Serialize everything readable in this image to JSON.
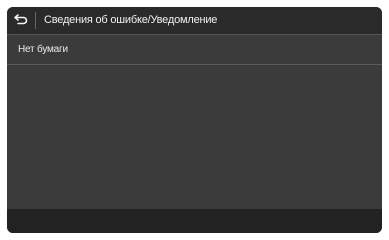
{
  "header": {
    "back_icon": "back-arrow-icon",
    "title": "Сведения об ошибке/Уведомление"
  },
  "list": {
    "items": [
      {
        "label": "Нет бумаги"
      }
    ]
  },
  "colors": {
    "panel_bg": "#3b3b3b",
    "header_bg": "#2a2a2a",
    "footer_bg": "#222222",
    "text": "#f2f2f2"
  }
}
